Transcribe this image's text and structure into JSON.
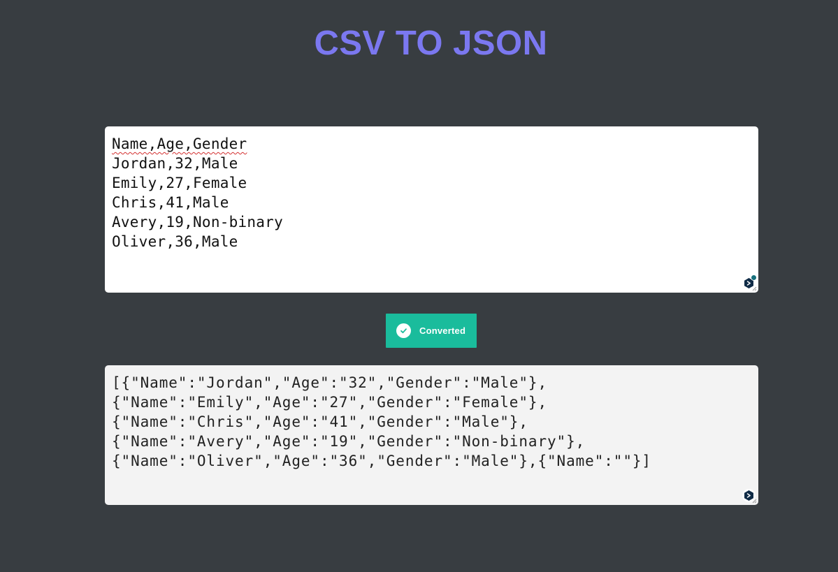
{
  "page": {
    "title": "CSV TO JSON",
    "title_color": "#7b78f0",
    "background": "#383d41"
  },
  "input": {
    "lines": [
      "Name,Age,Gender",
      "Jordan,32,Male",
      "Emily,27,Female",
      "Chris,41,Male",
      "Avery,19,Non-binary",
      "Oliver,36,Male"
    ]
  },
  "convert_button": {
    "label": "Converted",
    "color": "#1abc9c",
    "icon": "check-circle-icon"
  },
  "output": {
    "lines": [
      "[{\"Name\":\"Jordan\",\"Age\":\"32\",\"Gender\":\"Male\"},",
      "{\"Name\":\"Emily\",\"Age\":\"27\",\"Gender\":\"Female\"},",
      "{\"Name\":\"Chris\",\"Age\":\"41\",\"Gender\":\"Male\"},",
      "{\"Name\":\"Avery\",\"Age\":\"19\",\"Gender\":\"Non-binary\"},",
      "{\"Name\":\"Oliver\",\"Age\":\"36\",\"Gender\":\"Male\"},{\"Name\":\"\"}]"
    ]
  },
  "extensions": {
    "grammar_icon": "deepl-write-icon",
    "status_dot_color": "#17707c"
  }
}
